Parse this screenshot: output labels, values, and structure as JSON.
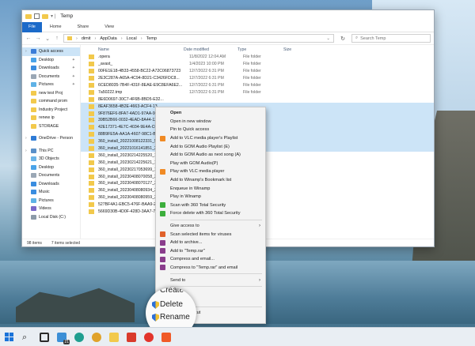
{
  "window": {
    "title": "Temp",
    "ribbon_tabs": [
      "File",
      "Home",
      "Share",
      "View"
    ],
    "breadcrumb": [
      "dimit",
      "AppData",
      "Local",
      "Temp"
    ],
    "search_placeholder": "Search Temp"
  },
  "columns": {
    "name": "Name",
    "date": "Date modified",
    "type": "Type",
    "size": "Size"
  },
  "nav": [
    {
      "label": "Quick access",
      "icon": "star-icon",
      "color": "#3b7dd8",
      "active": true,
      "chev": true
    },
    {
      "label": "Desktop",
      "icon": "desktop-icon",
      "color": "#4aa3e8",
      "pin": true
    },
    {
      "label": "Downloads",
      "icon": "download-icon",
      "color": "#3a8de0",
      "pin": true
    },
    {
      "label": "Documents",
      "icon": "documents-icon",
      "color": "#9aa7b5",
      "pin": true
    },
    {
      "label": "Pictures",
      "icon": "pictures-icon",
      "color": "#5fb2e6",
      "pin": true
    },
    {
      "label": "new test Proj",
      "icon": "folder-icon",
      "color": "#f2c94c"
    },
    {
      "label": "command prom",
      "icon": "folder-icon",
      "color": "#f2c94c"
    },
    {
      "label": "Industry Project",
      "icon": "folder-icon",
      "color": "#f2c94c"
    },
    {
      "label": "renew ip",
      "icon": "folder-icon",
      "color": "#f2c94c"
    },
    {
      "label": "STORAGE",
      "icon": "folder-icon",
      "color": "#f2c94c"
    },
    {
      "gap": true
    },
    {
      "label": "OneDrive - Person",
      "icon": "cloud-icon",
      "color": "#2f7bd6",
      "chev": true
    },
    {
      "gap": true
    },
    {
      "label": "This PC",
      "icon": "pc-icon",
      "color": "#5a90c9",
      "chev": true
    },
    {
      "label": "3D Objects",
      "icon": "cube-icon",
      "color": "#6cb5e8"
    },
    {
      "label": "Desktop",
      "icon": "desktop-icon",
      "color": "#4aa3e8"
    },
    {
      "label": "Documents",
      "icon": "documents-icon",
      "color": "#9aa7b5"
    },
    {
      "label": "Downloads",
      "icon": "download-icon",
      "color": "#3a8de0"
    },
    {
      "label": "Music",
      "icon": "music-icon",
      "color": "#3a8de0"
    },
    {
      "label": "Pictures",
      "icon": "pictures-icon",
      "color": "#5fb2e6"
    },
    {
      "label": "Videos",
      "icon": "videos-icon",
      "color": "#7a68c9"
    },
    {
      "label": "Local Disk (C:)",
      "icon": "disk-icon",
      "color": "#8c9aa8"
    }
  ],
  "files": [
    {
      "name": ".opera",
      "date": "11/8/2022 12:04 AM",
      "type": "File folder",
      "kind": "folder"
    },
    {
      "name": "_avast_",
      "date": "1/4/2023 10:00 PM",
      "type": "File folder",
      "kind": "folder"
    },
    {
      "name": "00FE1E18-4B33-4558-BC22-A72C06873723",
      "date": "12/7/2022 6:31 PM",
      "type": "File folder",
      "kind": "folder"
    },
    {
      "name": "2E3C287A-A65A-4C94-8D21-C3426FDC8...",
      "date": "12/7/2022 6:31 PM",
      "type": "File folder",
      "kind": "folder"
    },
    {
      "name": "6CED8035-7B4F-431F-8EAE-E9C8EFA6E2...",
      "date": "12/7/2022 6:31 PM",
      "type": "File folder",
      "kind": "folder"
    },
    {
      "name": "7a50222.tmp",
      "date": "12/7/2022 6:31 PM",
      "type": "File folder",
      "kind": "folder"
    },
    {
      "name": "8E6D0697-30C7-4F6B-8BD5-E32...",
      "date": "",
      "type": "",
      "kind": "folder"
    },
    {
      "name": "8EAF3658-4B2E-4663-ACF4-13...",
      "date": "",
      "type": "",
      "kind": "folder",
      "sel": true
    },
    {
      "name": "9F876EF6-8FA7-4AD1-97AA-95...",
      "date": "",
      "type": "",
      "kind": "folder",
      "sel": true
    },
    {
      "name": "39B52B66-0032-4EAD-8A44-12...",
      "date": "",
      "type": "",
      "kind": "folder",
      "sel": true
    },
    {
      "name": "42E17371-4E7C-4034-9E4A-C0...",
      "date": "",
      "type": "",
      "kind": "folder",
      "sel": true
    },
    {
      "name": "88B9FE5A-AA1A-4607-98C1-B8...",
      "date": "",
      "type": "",
      "kind": "folder",
      "sel": true
    },
    {
      "name": "360_install_20221008122331_50...",
      "date": "",
      "type": "",
      "kind": "folder",
      "sel": true
    },
    {
      "name": "360_install_20221016141851_22...",
      "date": "",
      "type": "",
      "kind": "folder",
      "sel": true
    },
    {
      "name": "360_install_20230214225520_12...",
      "date": "",
      "type": "",
      "kind": "folder"
    },
    {
      "name": "360_install_20230214225621_12...",
      "date": "",
      "type": "",
      "kind": "folder"
    },
    {
      "name": "360_install_20230217053699_10...",
      "date": "",
      "type": "",
      "kind": "folder"
    },
    {
      "name": "360_install_20230408070058_37...",
      "date": "",
      "type": "",
      "kind": "folder"
    },
    {
      "name": "360_install_20230408070127_37...",
      "date": "",
      "type": "",
      "kind": "folder"
    },
    {
      "name": "360_install_20230408080934_38...",
      "date": "",
      "type": "",
      "kind": "folder"
    },
    {
      "name": "360_install_20230408080959_38...",
      "date": "",
      "type": "",
      "kind": "folder"
    },
    {
      "name": "527BF4A1-EBC5-476F-BAA9-2C...",
      "date": "",
      "type": "",
      "kind": "folder"
    },
    {
      "name": "5669D30B-4D0F-428D-3AA7-7F...",
      "date": "",
      "type": "",
      "kind": "folder"
    }
  ],
  "status": {
    "count": "98 items",
    "selected": "7 items selected"
  },
  "context_menu": [
    {
      "label": "Open",
      "bold": true,
      "icon": "blank"
    },
    {
      "label": "Open in new window",
      "icon": "blank"
    },
    {
      "label": "Pin to Quick access",
      "icon": "blank"
    },
    {
      "label": "Add to VLC media player's Playlist",
      "icon": "vlc-icon",
      "color": "#f08a24"
    },
    {
      "label": "Add to GOM Audio Playlist (E)",
      "icon": "blank"
    },
    {
      "label": "Add to GOM Audio as next song (A)",
      "icon": "blank"
    },
    {
      "label": "Play with GOM Audio(P)",
      "icon": "blank"
    },
    {
      "label": "Play with VLC media player",
      "icon": "vlc-icon",
      "color": "#f08a24"
    },
    {
      "label": "Add to Winamp's Bookmark list",
      "icon": "blank"
    },
    {
      "label": "Enqueue in Winamp",
      "icon": "blank"
    },
    {
      "label": "Play in Winamp",
      "icon": "blank"
    },
    {
      "label": "Scan with 360 Total Security",
      "icon": "security-360-icon",
      "color": "#3cae3c"
    },
    {
      "label": "Force delete with 360 Total Security",
      "icon": "security-360-icon",
      "color": "#3cae3c"
    },
    {
      "sep": true
    },
    {
      "label": "Give access to",
      "icon": "blank",
      "arrow": true
    },
    {
      "label": "Scan selected items for viruses",
      "icon": "shield-icon",
      "color": "#e0612a"
    },
    {
      "label": "Add to archive...",
      "icon": "winrar-icon",
      "color": "#8a3d8c"
    },
    {
      "label": "Add to \"Temp.rar\"",
      "icon": "winrar-icon",
      "color": "#8a3d8c"
    },
    {
      "label": "Compress and email...",
      "icon": "winrar-icon",
      "color": "#8a3d8c"
    },
    {
      "label": "Compress to \"Temp.rar\" and email",
      "icon": "winrar-icon",
      "color": "#8a3d8c"
    },
    {
      "sep": true
    },
    {
      "label": "Send to",
      "icon": "blank",
      "arrow": true
    },
    {
      "sep": true
    },
    {
      "label": "Cut",
      "icon": "blank"
    },
    {
      "label": "Copy",
      "icon": "blank"
    },
    {
      "sep": true
    },
    {
      "label": "Create shortcut",
      "icon": "blank"
    },
    {
      "label": "Delete",
      "icon": "blank"
    },
    {
      "label": "Rename",
      "icon": "blank"
    },
    {
      "sep": true
    },
    {
      "label": "Properties",
      "icon": "blank"
    }
  ],
  "magnifier": {
    "line1": "Create",
    "line2": "Delete",
    "line3": "Rename"
  },
  "taskbar": {
    "items": [
      {
        "name": "start-icon",
        "color": "#1a73d9"
      },
      {
        "name": "search-icon",
        "color": "#2b2b2b"
      },
      {
        "name": "task-view-icon",
        "color": "#2b2b2b"
      },
      {
        "name": "widgets-icon",
        "color": "#3c8fd6",
        "badge": "21"
      },
      {
        "name": "edge-icon",
        "color": "#1f9e8f"
      },
      {
        "name": "chrome-icon",
        "color": "#e0a22a"
      },
      {
        "name": "file-explorer-icon",
        "color": "#f2c94c"
      },
      {
        "name": "taskbar-app-icon",
        "color": "#d93a2b"
      },
      {
        "name": "opera-icon",
        "color": "#e2342b"
      },
      {
        "name": "brave-icon",
        "color": "#f05a28"
      }
    ]
  }
}
